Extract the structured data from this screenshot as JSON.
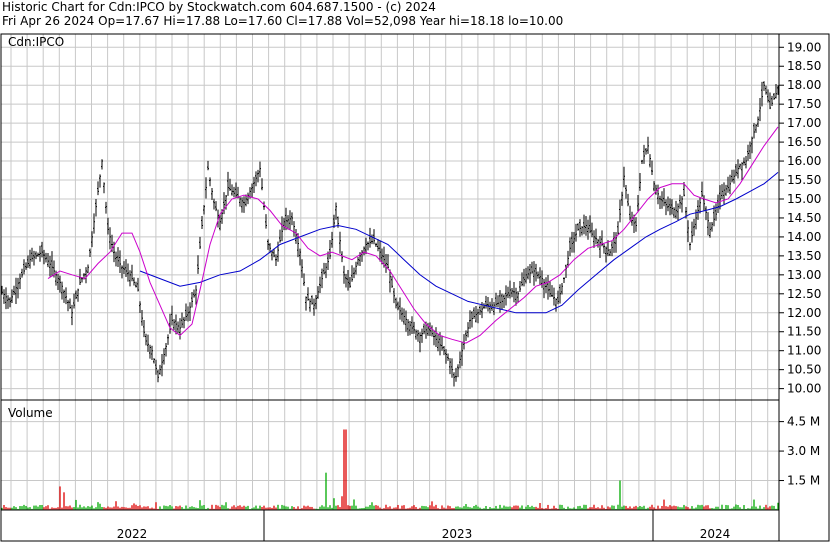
{
  "header": {
    "line1": "Historic Chart for Cdn:IPCO by Stockwatch.com 604.687.1500 - (c) 2024",
    "line2": "Fri Apr 26 2024   Op=17.67   Hi=17.88   Lo=17.60   Cl=17.88   Vol=52,098   Year hi=18.18   lo=10.00"
  },
  "chart_data": [
    {
      "type": "candlestick",
      "title": "Cdn:IPCO",
      "ylim": [
        9.7,
        19.35
      ],
      "y_ticks": [
        "19.00",
        "18.50",
        "18.00",
        "17.50",
        "17.00",
        "16.50",
        "16.00",
        "15.50",
        "15.00",
        "14.50",
        "14.00",
        "13.50",
        "13.00",
        "12.50",
        "12.00",
        "11.50",
        "11.00",
        "10.50",
        "10.00"
      ],
      "x_labels": [
        "2022",
        "2023",
        "2024"
      ],
      "grid": true,
      "price_path": [
        [
          0,
          12.6
        ],
        [
          10,
          12.3
        ],
        [
          20,
          12.9
        ],
        [
          30,
          13.4
        ],
        [
          42,
          13.6
        ],
        [
          52,
          13.2
        ],
        [
          62,
          12.7
        ],
        [
          72,
          12.0
        ],
        [
          80,
          12.8
        ],
        [
          88,
          13.2
        ],
        [
          95,
          14.6
        ],
        [
          102,
          16.0
        ],
        [
          108,
          14.2
        ],
        [
          115,
          13.5
        ],
        [
          122,
          13.2
        ],
        [
          130,
          13.0
        ],
        [
          138,
          12.6
        ],
        [
          145,
          11.3
        ],
        [
          152,
          11.0
        ],
        [
          158,
          10.3
        ],
        [
          165,
          11.0
        ],
        [
          172,
          11.8
        ],
        [
          180,
          11.6
        ],
        [
          188,
          12.0
        ],
        [
          196,
          12.6
        ],
        [
          202,
          14.3
        ],
        [
          208,
          15.8
        ],
        [
          214,
          14.9
        ],
        [
          220,
          14.4
        ],
        [
          228,
          15.3
        ],
        [
          236,
          15.1
        ],
        [
          244,
          14.9
        ],
        [
          252,
          15.3
        ],
        [
          260,
          15.8
        ],
        [
          268,
          13.8
        ],
        [
          276,
          13.4
        ],
        [
          284,
          14.4
        ],
        [
          292,
          14.5
        ],
        [
          300,
          13.6
        ],
        [
          306,
          12.4
        ],
        [
          314,
          12.2
        ],
        [
          322,
          12.9
        ],
        [
          330,
          13.5
        ],
        [
          336,
          14.8
        ],
        [
          344,
          13.0
        ],
        [
          350,
          12.7
        ],
        [
          358,
          13.4
        ],
        [
          366,
          13.8
        ],
        [
          374,
          13.9
        ],
        [
          380,
          13.6
        ],
        [
          388,
          13.2
        ],
        [
          396,
          12.2
        ],
        [
          404,
          11.9
        ],
        [
          412,
          11.6
        ],
        [
          420,
          11.4
        ],
        [
          428,
          11.6
        ],
        [
          436,
          11.3
        ],
        [
          444,
          11.0
        ],
        [
          450,
          10.7
        ],
        [
          455,
          10.2
        ],
        [
          462,
          11.0
        ],
        [
          470,
          11.8
        ],
        [
          478,
          12.0
        ],
        [
          486,
          12.2
        ],
        [
          494,
          12.2
        ],
        [
          502,
          12.3
        ],
        [
          510,
          12.6
        ],
        [
          518,
          12.5
        ],
        [
          526,
          13.0
        ],
        [
          534,
          13.1
        ],
        [
          542,
          12.9
        ],
        [
          550,
          12.5
        ],
        [
          558,
          12.3
        ],
        [
          564,
          12.9
        ],
        [
          570,
          13.7
        ],
        [
          578,
          14.2
        ],
        [
          586,
          14.3
        ],
        [
          594,
          14.0
        ],
        [
          602,
          13.8
        ],
        [
          610,
          13.6
        ],
        [
          618,
          14.1
        ],
        [
          624,
          15.6
        ],
        [
          630,
          14.5
        ],
        [
          636,
          14.3
        ],
        [
          642,
          16.0
        ],
        [
          648,
          16.4
        ],
        [
          654,
          15.4
        ],
        [
          660,
          15.0
        ],
        [
          668,
          14.8
        ],
        [
          676,
          14.7
        ],
        [
          684,
          15.1
        ],
        [
          690,
          13.8
        ],
        [
          696,
          14.5
        ],
        [
          702,
          15.1
        ],
        [
          710,
          14.2
        ],
        [
          716,
          14.6
        ],
        [
          722,
          15.2
        ],
        [
          728,
          15.3
        ],
        [
          734,
          15.6
        ],
        [
          740,
          15.9
        ],
        [
          746,
          16.0
        ],
        [
          752,
          16.6
        ],
        [
          758,
          17.1
        ],
        [
          764,
          18.0
        ],
        [
          770,
          17.4
        ],
        [
          778,
          17.9
        ]
      ],
      "ma_fast": [
        [
          48,
          12.9
        ],
        [
          60,
          13.1
        ],
        [
          72,
          13.0
        ],
        [
          85,
          12.9
        ],
        [
          98,
          13.3
        ],
        [
          110,
          13.6
        ],
        [
          122,
          14.1
        ],
        [
          132,
          14.1
        ],
        [
          140,
          13.6
        ],
        [
          150,
          12.8
        ],
        [
          160,
          12.2
        ],
        [
          170,
          11.6
        ],
        [
          180,
          11.4
        ],
        [
          192,
          11.7
        ],
        [
          200,
          12.6
        ],
        [
          210,
          13.8
        ],
        [
          220,
          14.6
        ],
        [
          232,
          15.0
        ],
        [
          244,
          15.1
        ],
        [
          258,
          15.0
        ],
        [
          270,
          14.7
        ],
        [
          282,
          14.3
        ],
        [
          296,
          14.1
        ],
        [
          308,
          13.7
        ],
        [
          320,
          13.5
        ],
        [
          332,
          13.6
        ],
        [
          342,
          13.5
        ],
        [
          352,
          13.4
        ],
        [
          364,
          13.6
        ],
        [
          376,
          13.5
        ],
        [
          390,
          13.1
        ],
        [
          402,
          12.6
        ],
        [
          414,
          12.1
        ],
        [
          426,
          11.7
        ],
        [
          440,
          11.4
        ],
        [
          452,
          11.3
        ],
        [
          466,
          11.2
        ],
        [
          480,
          11.4
        ],
        [
          496,
          11.8
        ],
        [
          510,
          12.1
        ],
        [
          524,
          12.4
        ],
        [
          536,
          12.7
        ],
        [
          548,
          12.8
        ],
        [
          560,
          13.0
        ],
        [
          574,
          13.4
        ],
        [
          588,
          13.7
        ],
        [
          600,
          13.8
        ],
        [
          612,
          13.9
        ],
        [
          624,
          14.2
        ],
        [
          636,
          14.6
        ],
        [
          648,
          15.0
        ],
        [
          660,
          15.3
        ],
        [
          672,
          15.4
        ],
        [
          684,
          15.4
        ],
        [
          694,
          15.1
        ],
        [
          704,
          15.0
        ],
        [
          716,
          14.9
        ],
        [
          728,
          15.0
        ],
        [
          740,
          15.4
        ],
        [
          752,
          15.9
        ],
        [
          764,
          16.4
        ],
        [
          778,
          16.9
        ]
      ],
      "ma_slow": [
        [
          140,
          13.1
        ],
        [
          160,
          12.9
        ],
        [
          180,
          12.7
        ],
        [
          200,
          12.8
        ],
        [
          220,
          13.0
        ],
        [
          240,
          13.1
        ],
        [
          260,
          13.4
        ],
        [
          280,
          13.8
        ],
        [
          300,
          14.0
        ],
        [
          320,
          14.2
        ],
        [
          338,
          14.3
        ],
        [
          356,
          14.2
        ],
        [
          372,
          14.0
        ],
        [
          388,
          13.8
        ],
        [
          404,
          13.4
        ],
        [
          420,
          13.0
        ],
        [
          436,
          12.7
        ],
        [
          452,
          12.5
        ],
        [
          468,
          12.3
        ],
        [
          484,
          12.2
        ],
        [
          500,
          12.1
        ],
        [
          516,
          12.0
        ],
        [
          530,
          12.0
        ],
        [
          546,
          12.0
        ],
        [
          562,
          12.2
        ],
        [
          578,
          12.6
        ],
        [
          596,
          13.0
        ],
        [
          614,
          13.4
        ],
        [
          630,
          13.7
        ],
        [
          646,
          14.0
        ],
        [
          660,
          14.2
        ],
        [
          676,
          14.4
        ],
        [
          690,
          14.6
        ],
        [
          706,
          14.7
        ],
        [
          720,
          14.8
        ],
        [
          736,
          15.0
        ],
        [
          750,
          15.2
        ],
        [
          764,
          15.4
        ],
        [
          778,
          15.7
        ]
      ],
      "colors": {
        "price_bars": "#000000",
        "ma_fast": "#cc00cc",
        "ma_slow": "#0000cc"
      }
    },
    {
      "type": "bar",
      "title": "Volume",
      "y_ticks": [
        "4.5 M",
        "3.0 M",
        "1.5 M"
      ],
      "ylim": [
        0,
        5.6
      ],
      "spikes": [
        [
          60,
          1.2
        ],
        [
          64,
          0.9
        ],
        [
          98,
          0.4
        ],
        [
          200,
          0.5
        ],
        [
          326,
          1.9
        ],
        [
          334,
          0.6
        ],
        [
          342,
          0.7
        ],
        [
          345,
          4.1
        ],
        [
          620,
          1.5
        ]
      ],
      "colors": {
        "up": "#00aa00",
        "down": "#dd0000"
      }
    }
  ]
}
